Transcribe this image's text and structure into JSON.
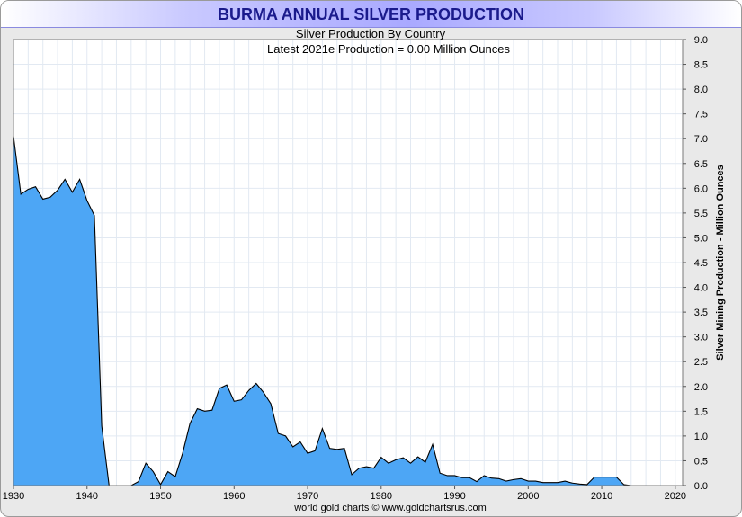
{
  "chart_data": {
    "type": "area",
    "title": "BURMA ANNUAL SILVER PRODUCTION",
    "subtitle": "Silver Production By Country",
    "annotation": "Latest 2021e Production = 0.00 Million Ounces",
    "xlabel": "",
    "ylabel": "Silver Mining Production - Million Ounces",
    "xlim": [
      1930,
      2021
    ],
    "ylim": [
      0,
      9
    ],
    "x_ticks": [
      "1930",
      "1940",
      "1950",
      "1960",
      "1970",
      "1980",
      "1990",
      "2000",
      "2010",
      "2020"
    ],
    "y_ticks": [
      "0.0",
      "0.5",
      "1.0",
      "1.5",
      "2.0",
      "2.5",
      "3.0",
      "3.5",
      "4.0",
      "4.5",
      "5.0",
      "5.5",
      "6.0",
      "6.5",
      "7.0",
      "7.5",
      "8.0",
      "8.5",
      "9.0"
    ],
    "y_axis_side": "right",
    "grid": true,
    "fill_color": "#4da6f5",
    "line_color": "#000000",
    "series": [
      {
        "x": [
          1930,
          1931,
          1932,
          1933,
          1934,
          1935,
          1936,
          1937,
          1938,
          1939,
          1940,
          1941,
          1942,
          1943,
          1944,
          1945,
          1946,
          1947,
          1948,
          1949,
          1950,
          1951,
          1952,
          1953,
          1954,
          1955,
          1956,
          1957,
          1958,
          1959,
          1960,
          1961,
          1962,
          1963,
          1964,
          1965,
          1966,
          1967,
          1968,
          1969,
          1970,
          1971,
          1972,
          1973,
          1974,
          1975,
          1976,
          1977,
          1978,
          1979,
          1980,
          1981,
          1982,
          1983,
          1984,
          1985,
          1986,
          1987,
          1988,
          1989,
          1990,
          1991,
          1992,
          1993,
          1994,
          1995,
          1996,
          1997,
          1998,
          1999,
          2000,
          2001,
          2002,
          2003,
          2004,
          2005,
          2006,
          2007,
          2008,
          2009,
          2010,
          2011,
          2012,
          2013,
          2014,
          2015,
          2016,
          2017,
          2018,
          2019,
          2020,
          2021
        ],
        "values": [
          7.05,
          5.88,
          5.98,
          6.03,
          5.78,
          5.82,
          5.96,
          6.18,
          5.92,
          6.18,
          5.75,
          5.45,
          1.2,
          0,
          0,
          0,
          0,
          0.08,
          0.45,
          0.28,
          0.02,
          0.28,
          0.18,
          0.65,
          1.25,
          1.55,
          1.5,
          1.52,
          1.96,
          2.03,
          1.7,
          1.73,
          1.92,
          2.06,
          1.88,
          1.65,
          1.05,
          1.0,
          0.78,
          0.88,
          0.65,
          0.7,
          1.15,
          0.75,
          0.73,
          0.75,
          0.22,
          0.35,
          0.38,
          0.35,
          0.57,
          0.45,
          0.52,
          0.56,
          0.45,
          0.58,
          0.47,
          0.83,
          0.25,
          0.2,
          0.2,
          0.16,
          0.16,
          0.08,
          0.2,
          0.15,
          0.14,
          0.09,
          0.12,
          0.14,
          0.09,
          0.09,
          0.06,
          0.06,
          0.06,
          0.09,
          0.05,
          0.03,
          0.02,
          0.17,
          0.17,
          0.17,
          0.17,
          0.02,
          0,
          0,
          0,
          0,
          0,
          0,
          0,
          0
        ]
      }
    ]
  },
  "footer": {
    "credit": "world gold charts © www.goldchartsrus.com"
  }
}
